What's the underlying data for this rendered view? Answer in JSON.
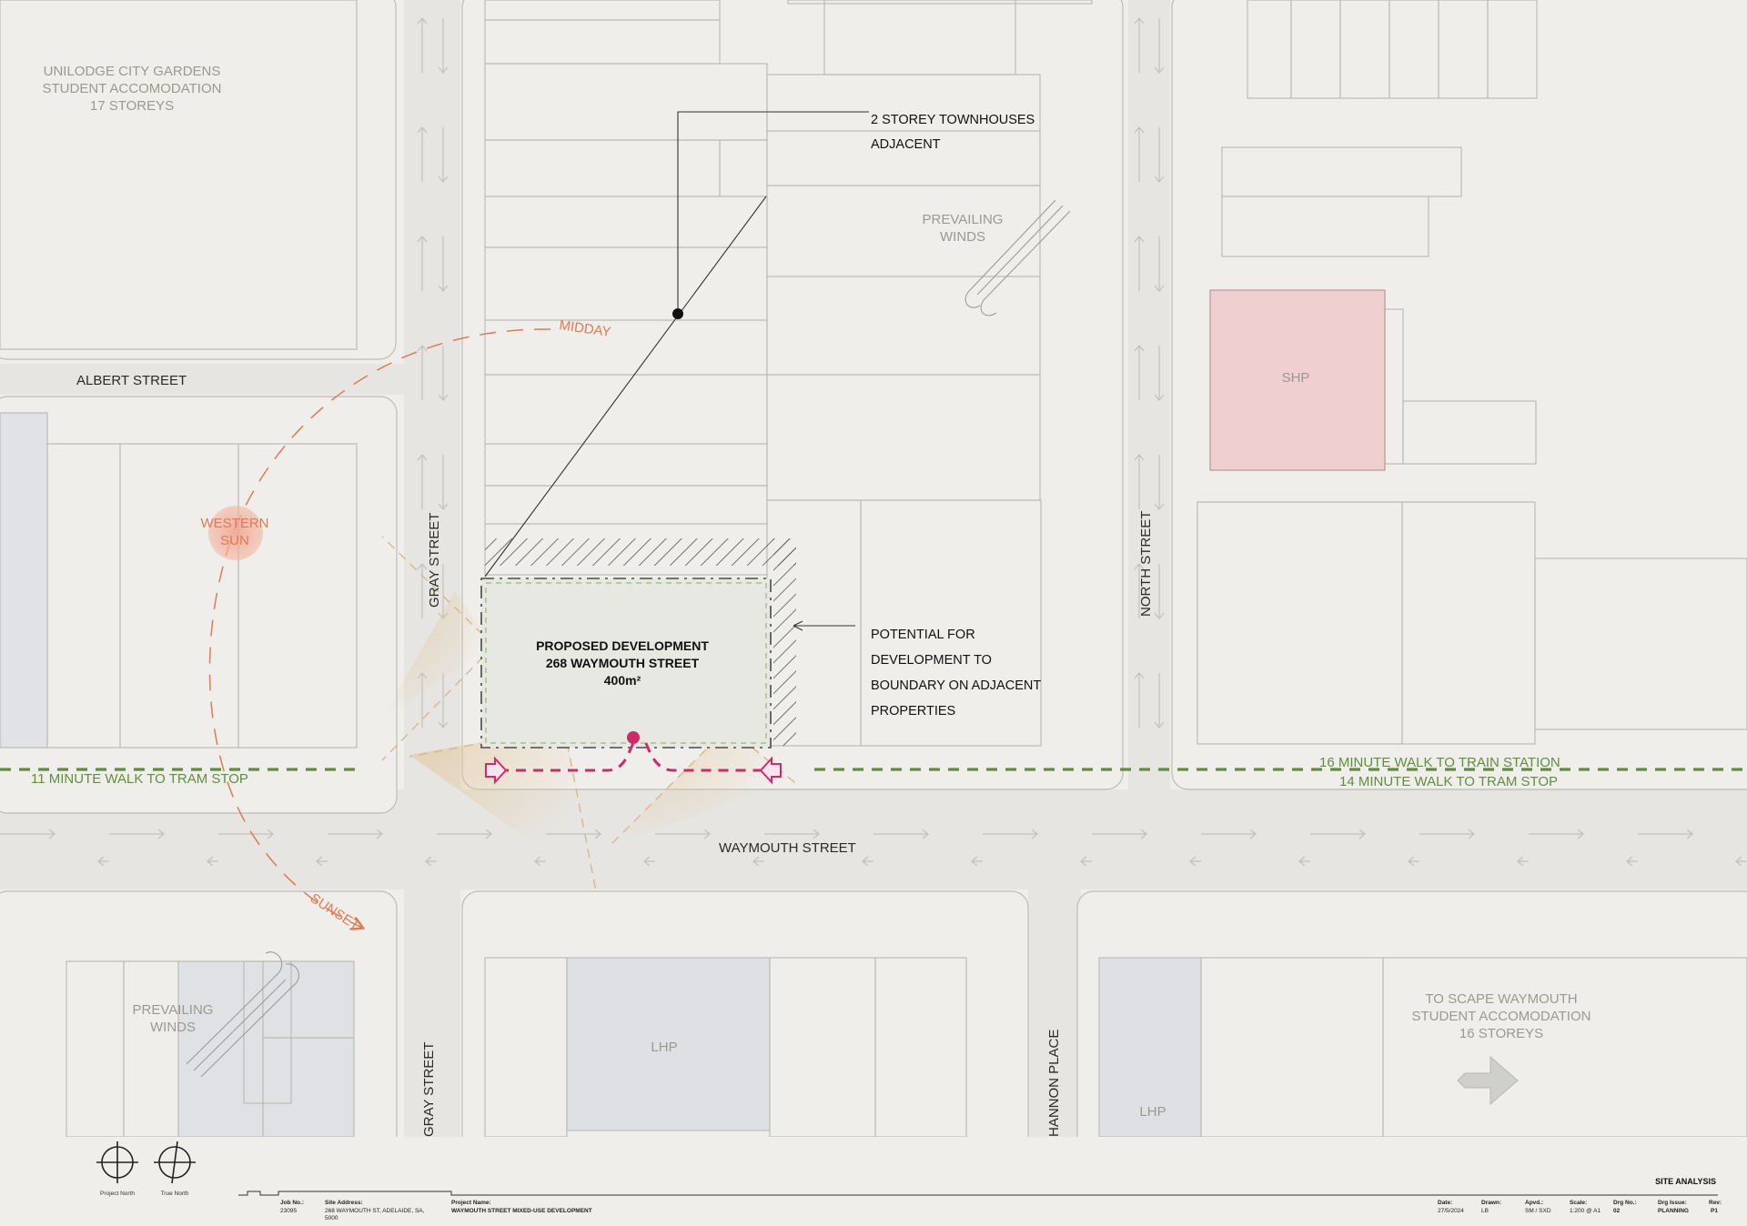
{
  "colors": {
    "paper": "#efeeea",
    "road": "#e3e2de",
    "block": "#e7e6e2",
    "outline": "#b8b7b3",
    "sun_path": "#e07a55",
    "walk_route": "#5f8f3e",
    "access": "#cf2a6a",
    "view_cone": "#e9c99a",
    "shp_fill": "#efcfcf",
    "lhp_fill": "#dfe0e3",
    "site_fill": "#e7e8e1",
    "label_grey": "#9a9994",
    "ink": "#222222"
  },
  "icons": [
    "project-north-icon",
    "true-north-icon",
    "wind-icon",
    "arrow-right-icon",
    "sun-icon"
  ],
  "streets": {
    "albert": "ALBERT STREET",
    "gray_north": "GRAY STREET",
    "gray_south": "GRAY STREET",
    "north": "NORTH STREET",
    "waymouth": "WAYMOUTH STREET",
    "hannon": "HANNON PLACE"
  },
  "buildings": {
    "unilodge": [
      "UNILODGE CITY GARDENS",
      "STUDENT ACCOMODATION",
      "17 STOREYS"
    ],
    "shp": "SHP",
    "lhp_center": "LHP",
    "lhp_right": "LHP",
    "scape": [
      "TO SCAPE WAYMOUTH",
      "STUDENT ACCOMODATION",
      "16 STOREYS"
    ]
  },
  "site": {
    "line1": "PROPOSED DEVELOPMENT",
    "line2": "268 WAYMOUTH STREET",
    "area": "400m²"
  },
  "annotations": {
    "townhouses": [
      "2 STOREY TOWNHOUSES",
      "ADJACENT"
    ],
    "boundary": [
      "POTENTIAL FOR",
      "DEVELOPMENT TO",
      "BOUNDARY ON ADJACENT",
      "PROPERTIES"
    ],
    "winds_top": [
      "PREVAILING",
      "WINDS"
    ],
    "winds_bottom": [
      "PREVAILING",
      "WINDS"
    ]
  },
  "sun": {
    "midday": "MIDDAY",
    "western": [
      "WESTERN",
      "SUN"
    ],
    "sunset": "SUNSET"
  },
  "walks": {
    "tram_left": "11 MINUTE WALK TO TRAM STOP",
    "train": "16 MINUTE WALK TO TRAIN STATION",
    "tram_right": "14 MINUTE WALK TO TRAM STOP"
  },
  "title_block": {
    "sheet_title": "SITE ANALYSIS",
    "north_project": "Project North",
    "north_true": "True North",
    "job_no_label": "Job No.:",
    "job_no": "23095",
    "address_label": "Site Address:",
    "address": [
      "268 WAYMOUTH ST, ADELAIDE, SA,",
      "5000"
    ],
    "project_label": "Project Name:",
    "project": "WAYMOUTH STREET MIXED-USE DEVELOPMENT",
    "date_label": "Date:",
    "date": "27/5/2024",
    "drawn_label": "Drawn:",
    "drawn": "LB",
    "apvd_label": "Apvd.:",
    "apvd": "SM / SXD",
    "scale_label": "Scale:",
    "scale": "1:200 @ A1",
    "drg_no_label": "Drg No.:",
    "drg_no": "02",
    "drg_issue_label": "Drg Issue:",
    "drg_issue": "PLANNING",
    "rev_label": "Rev:",
    "rev": "P1"
  }
}
